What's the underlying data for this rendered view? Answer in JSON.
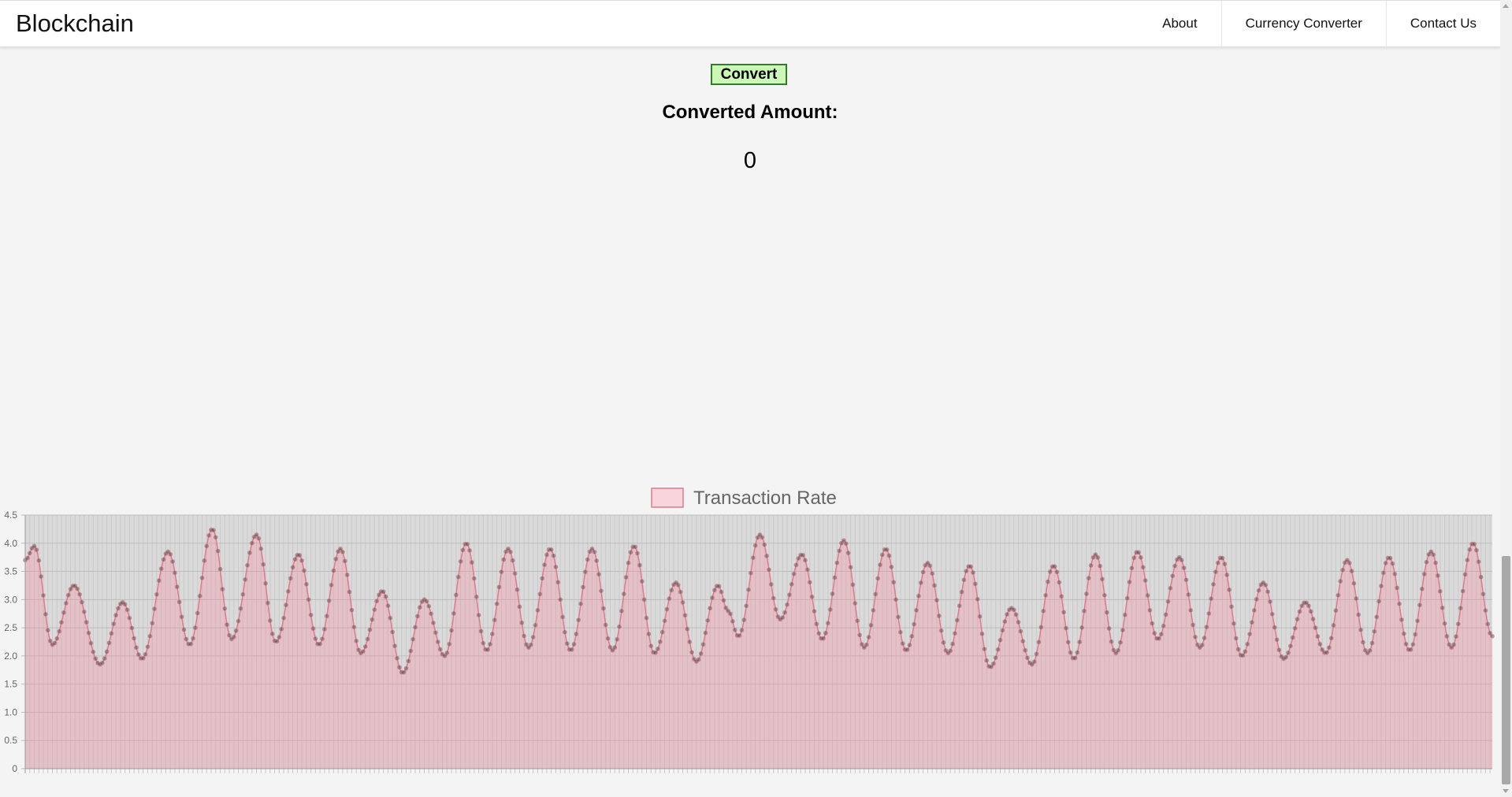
{
  "navbar": {
    "brand": "Blockchain",
    "links": [
      "About",
      "Currency Converter",
      "Contact Us"
    ]
  },
  "converter": {
    "convert_label": "Convert",
    "converted_label": "Converted Amount:",
    "converted_value": "0"
  },
  "colors": {
    "accent_button_bg": "#ccf7b6",
    "accent_button_border": "#2f7d25",
    "series_fill": "rgba(255,120,145,0.25)",
    "series_line": "#e07a8e",
    "point_color": "#444444"
  },
  "chart_data": {
    "type": "area",
    "legend": {
      "label": "Transaction Rate",
      "position": "top-center"
    },
    "ylim": [
      0,
      4.5
    ],
    "y_ticks": [
      "0",
      "0.5",
      "1.0",
      "1.5",
      "2.0",
      "2.5",
      "3.0",
      "3.5",
      "4.0",
      "4.5"
    ],
    "grid": true,
    "series": [
      {
        "name": "Transaction Rate",
        "keypoints": [
          [
            0,
            3.7
          ],
          [
            8,
            3.95
          ],
          [
            24,
            2.2
          ],
          [
            43,
            3.25
          ],
          [
            66,
            1.85
          ],
          [
            86,
            2.95
          ],
          [
            103,
            1.95
          ],
          [
            126,
            3.85
          ],
          [
            145,
            2.2
          ],
          [
            165,
            4.25
          ],
          [
            182,
            2.3
          ],
          [
            204,
            4.15
          ],
          [
            221,
            2.25
          ],
          [
            241,
            3.8
          ],
          [
            259,
            2.2
          ],
          [
            278,
            3.9
          ],
          [
            296,
            2.05
          ],
          [
            315,
            3.15
          ],
          [
            333,
            1.7
          ],
          [
            352,
            3.0
          ],
          [
            370,
            2.0
          ],
          [
            389,
            4.0
          ],
          [
            407,
            2.1
          ],
          [
            426,
            3.9
          ],
          [
            444,
            2.15
          ],
          [
            463,
            3.9
          ],
          [
            481,
            2.1
          ],
          [
            500,
            3.9
          ],
          [
            518,
            2.1
          ],
          [
            537,
            3.95
          ],
          [
            555,
            2.05
          ],
          [
            574,
            3.3
          ],
          [
            592,
            1.9
          ],
          [
            611,
            3.25
          ],
          [
            620,
            2.8
          ],
          [
            629,
            2.35
          ],
          [
            648,
            4.15
          ],
          [
            666,
            2.65
          ],
          [
            685,
            3.8
          ],
          [
            703,
            2.3
          ],
          [
            722,
            4.05
          ],
          [
            740,
            2.15
          ],
          [
            759,
            3.9
          ],
          [
            777,
            2.1
          ],
          [
            796,
            3.65
          ],
          [
            814,
            2.05
          ],
          [
            833,
            3.6
          ],
          [
            851,
            1.8
          ],
          [
            870,
            2.85
          ],
          [
            888,
            1.85
          ],
          [
            907,
            3.6
          ],
          [
            925,
            1.95
          ],
          [
            944,
            3.8
          ],
          [
            962,
            2.05
          ],
          [
            981,
            3.85
          ],
          [
            999,
            2.3
          ],
          [
            1018,
            3.75
          ],
          [
            1036,
            2.15
          ],
          [
            1055,
            3.75
          ],
          [
            1073,
            2.0
          ],
          [
            1092,
            3.3
          ],
          [
            1110,
            1.95
          ],
          [
            1129,
            2.95
          ],
          [
            1147,
            2.05
          ],
          [
            1166,
            3.7
          ],
          [
            1184,
            2.05
          ],
          [
            1203,
            3.75
          ],
          [
            1221,
            2.1
          ],
          [
            1240,
            3.85
          ],
          [
            1258,
            2.15
          ],
          [
            1277,
            4.0
          ],
          [
            1294,
            2.35
          ]
        ]
      }
    ]
  }
}
